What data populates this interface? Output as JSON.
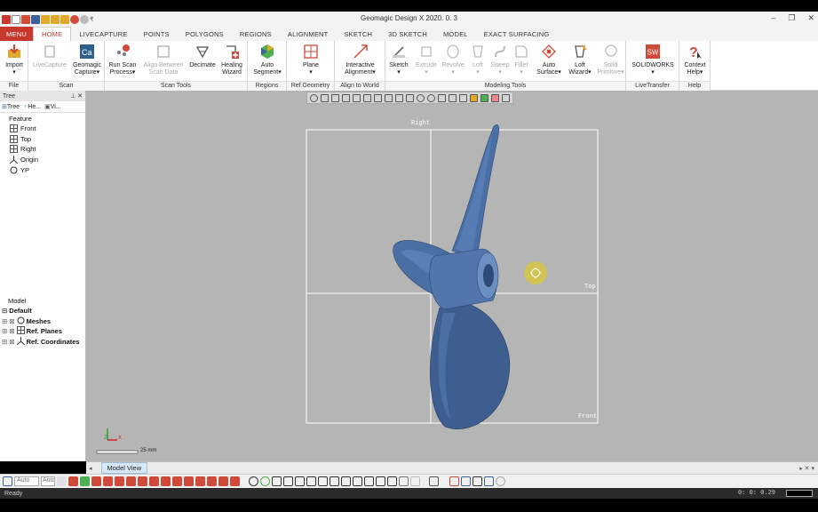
{
  "app": {
    "title": "Geomagic Design X 2020. 0. 3"
  },
  "menu": {
    "menu_label": "MENU",
    "tabs": [
      "HOME",
      "LIVECAPTURE",
      "POINTS",
      "POLYGONS",
      "REGIONS",
      "ALIGNMENT",
      "SKETCH",
      "3D SKETCH",
      "MODEL",
      "EXACT SURFACING"
    ],
    "active": "HOME"
  },
  "ribbon": {
    "groups": [
      {
        "label": "File",
        "buttons": [
          {
            "l1": "Import",
            "l2": "",
            "icon": "import-icon",
            "disabled": false
          }
        ]
      },
      {
        "label": "Scan",
        "buttons": [
          {
            "l1": "LiveCapture",
            "l2": "",
            "icon": "livecapture-icon",
            "disabled": true
          },
          {
            "l1": "Geomagic",
            "l2": "Capture▾",
            "icon": "capture-icon",
            "disabled": false
          }
        ]
      },
      {
        "label": "Scan Tools",
        "buttons": [
          {
            "l1": "Run Scan",
            "l2": "Process▾",
            "icon": "run-scan-icon",
            "disabled": false
          },
          {
            "l1": "Align Between",
            "l2": "Scan Data",
            "icon": "align-scan-icon",
            "disabled": true
          },
          {
            "l1": "Decimate",
            "l2": "",
            "icon": "decimate-icon",
            "disabled": false
          },
          {
            "l1": "Healing",
            "l2": "Wizard",
            "icon": "healing-icon",
            "disabled": false
          }
        ]
      },
      {
        "label": "Regions",
        "buttons": [
          {
            "l1": "Auto",
            "l2": "Segment▾",
            "icon": "segment-icon",
            "disabled": false
          }
        ]
      },
      {
        "label": "Ref.Geometry",
        "buttons": [
          {
            "l1": "Plane",
            "l2": "▾",
            "icon": "plane-icon",
            "disabled": false
          }
        ]
      },
      {
        "label": "Align to World",
        "buttons": [
          {
            "l1": "Interactive",
            "l2": "Alignment▾",
            "icon": "alignment-icon",
            "disabled": false
          }
        ]
      },
      {
        "label": "Modeling Tools",
        "buttons": [
          {
            "l1": "Sketch",
            "l2": "▾",
            "icon": "sketch-icon",
            "disabled": false
          },
          {
            "l1": "Extrude",
            "l2": "▾",
            "icon": "extrude-icon",
            "disabled": true
          },
          {
            "l1": "Revolve",
            "l2": "▾",
            "icon": "revolve-icon",
            "disabled": true
          },
          {
            "l1": "Loft",
            "l2": "▾",
            "icon": "loft-icon",
            "disabled": true
          },
          {
            "l1": "Sweep",
            "l2": "▾",
            "icon": "sweep-icon",
            "disabled": true
          },
          {
            "l1": "Fillet",
            "l2": "▾",
            "icon": "fillet-icon",
            "disabled": true
          },
          {
            "l1": "Auto",
            "l2": "Surface▾",
            "icon": "auto-surface-icon",
            "disabled": false
          },
          {
            "l1": "Loft",
            "l2": "Wizard▾",
            "icon": "loft-wizard-icon",
            "disabled": false
          },
          {
            "l1": "Solid",
            "l2": "Primitive▾",
            "icon": "solid-primitive-icon",
            "disabled": true
          }
        ]
      },
      {
        "label": "LiveTransfer",
        "buttons": [
          {
            "l1": "SOLIDWORKS",
            "l2": "▾",
            "icon": "solidworks-icon",
            "disabled": false
          }
        ]
      },
      {
        "label": "Help",
        "buttons": [
          {
            "l1": "Context",
            "l2": "Help▾",
            "icon": "context-help-icon",
            "disabled": false
          }
        ]
      }
    ]
  },
  "sidebar": {
    "header": "Tree",
    "tabs": [
      "Tree",
      "He...",
      "Vi..."
    ],
    "feature_title": "Feature",
    "features": [
      {
        "label": "Front",
        "icon": "plane-icon"
      },
      {
        "label": "Top",
        "icon": "plane-icon"
      },
      {
        "label": "Right",
        "icon": "plane-icon"
      },
      {
        "label": "Origin",
        "icon": "origin-icon"
      },
      {
        "label": "YP",
        "icon": "mesh-icon"
      }
    ],
    "model_title": "Model",
    "model_default": "Default",
    "model_items": [
      {
        "label": "Meshes",
        "icon": "mesh-icon"
      },
      {
        "label": "Ref. Planes",
        "icon": "plane-icon"
      },
      {
        "label": "Ref. Coordinates",
        "icon": "origin-icon"
      }
    ]
  },
  "viewport": {
    "plane_labels": {
      "right": "Right",
      "top": "Top",
      "front": "Front"
    },
    "scale_label": "25 mm",
    "axis_z": "Z",
    "axis_x": "X",
    "model_tab": "Model View"
  },
  "toolbar2": {
    "combo1": "Auto",
    "combo2": "Auto"
  },
  "status": {
    "left": "Ready",
    "right": "0: 0: 0.29"
  },
  "colors": {
    "accent": "#c8372d",
    "viewport_bg": "#b5b5b5",
    "model_blue": "#4a6fa5"
  }
}
